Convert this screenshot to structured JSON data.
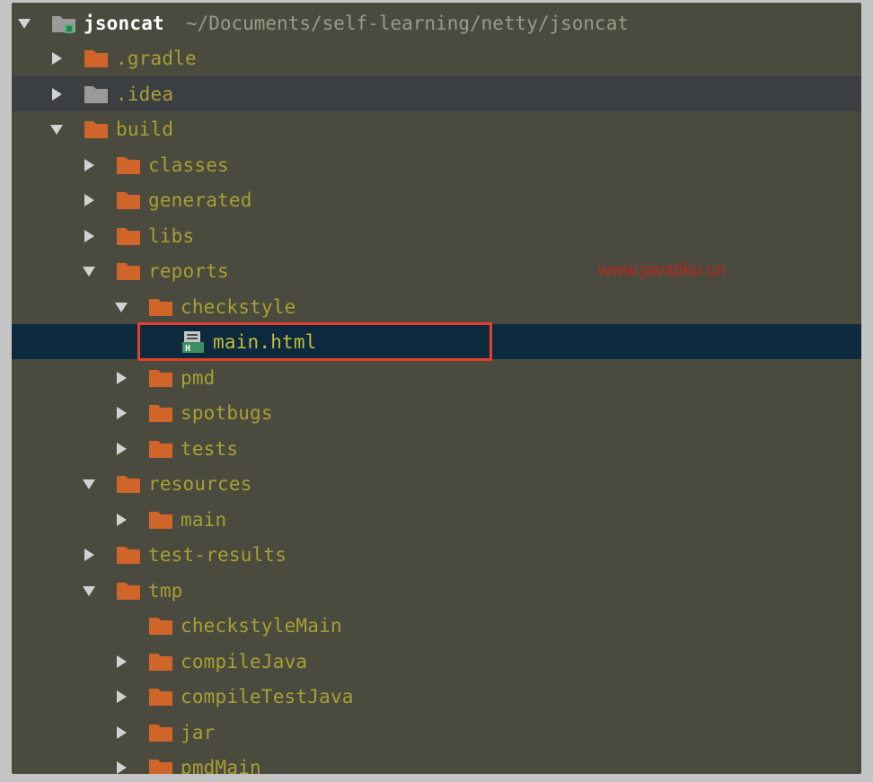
{
  "root": {
    "name": "jsoncat",
    "path": "~/Documents/self-learning/netty/jsoncat"
  },
  "tree": [
    {
      "label": ".gradle",
      "depth": 1,
      "arrow": "collapsed",
      "icon": "folder",
      "state": ""
    },
    {
      "label": ".idea",
      "depth": 1,
      "arrow": "collapsed",
      "icon": "folder-gray",
      "state": "hover"
    },
    {
      "label": "build",
      "depth": 1,
      "arrow": "expanded",
      "icon": "folder",
      "state": ""
    },
    {
      "label": "classes",
      "depth": 2,
      "arrow": "collapsed",
      "icon": "folder",
      "state": ""
    },
    {
      "label": "generated",
      "depth": 2,
      "arrow": "collapsed",
      "icon": "folder",
      "state": ""
    },
    {
      "label": "libs",
      "depth": 2,
      "arrow": "collapsed",
      "icon": "folder",
      "state": ""
    },
    {
      "label": "reports",
      "depth": 2,
      "arrow": "expanded",
      "icon": "folder",
      "state": ""
    },
    {
      "label": "checkstyle",
      "depth": 3,
      "arrow": "expanded",
      "icon": "folder",
      "state": ""
    },
    {
      "label": "main.html",
      "depth": 4,
      "arrow": "none",
      "icon": "html-file",
      "state": "selected"
    },
    {
      "label": "pmd",
      "depth": 3,
      "arrow": "collapsed",
      "icon": "folder",
      "state": ""
    },
    {
      "label": "spotbugs",
      "depth": 3,
      "arrow": "collapsed",
      "icon": "folder",
      "state": ""
    },
    {
      "label": "tests",
      "depth": 3,
      "arrow": "collapsed",
      "icon": "folder",
      "state": ""
    },
    {
      "label": "resources",
      "depth": 2,
      "arrow": "expanded",
      "icon": "folder",
      "state": ""
    },
    {
      "label": "main",
      "depth": 3,
      "arrow": "collapsed",
      "icon": "folder",
      "state": ""
    },
    {
      "label": "test-results",
      "depth": 2,
      "arrow": "collapsed",
      "icon": "folder",
      "state": ""
    },
    {
      "label": "tmp",
      "depth": 2,
      "arrow": "expanded",
      "icon": "folder",
      "state": ""
    },
    {
      "label": "checkstyleMain",
      "depth": 3,
      "arrow": "none",
      "icon": "folder",
      "state": ""
    },
    {
      "label": "compileJava",
      "depth": 3,
      "arrow": "collapsed",
      "icon": "folder",
      "state": ""
    },
    {
      "label": "compileTestJava",
      "depth": 3,
      "arrow": "collapsed",
      "icon": "folder",
      "state": ""
    },
    {
      "label": "jar",
      "depth": 3,
      "arrow": "collapsed",
      "icon": "folder",
      "state": ""
    },
    {
      "label": "pmdMain",
      "depth": 3,
      "arrow": "collapsed",
      "icon": "folder",
      "state": ""
    }
  ],
  "watermark": "www.javatiku.cn",
  "colors": {
    "folder": "#d0652a",
    "folder_gray": "#9a9a9a",
    "label": "#a7a034",
    "selected_bg": "#0d293e",
    "highlight_border": "#e3402c",
    "watermark": "#b5271c"
  }
}
